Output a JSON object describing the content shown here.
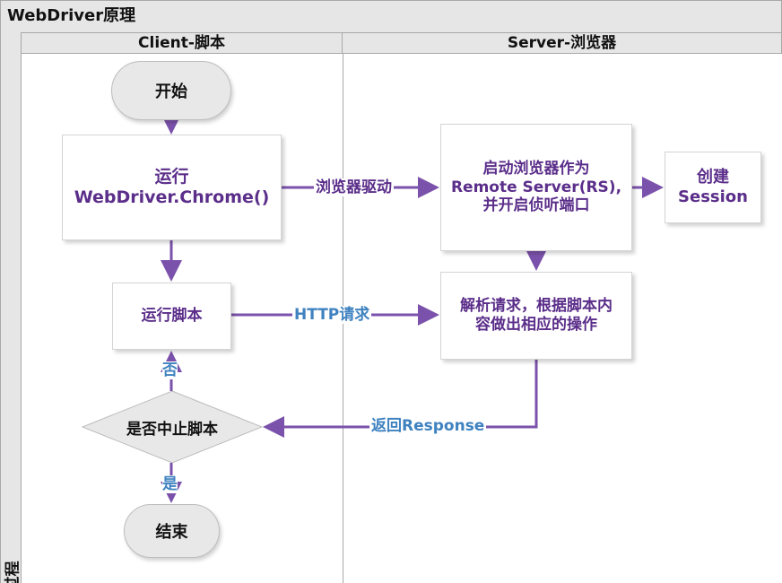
{
  "title": "WebDriver原理",
  "side_label": "过程",
  "lanes": {
    "client": "Client-脚本",
    "server": "Server-浏览器"
  },
  "nodes": {
    "start": "开始",
    "run_chrome": [
      "运行",
      "WebDriver.Chrome()"
    ],
    "run_script": "运行脚本",
    "launch_browser": [
      "启动浏览器作为",
      "Remote Server(RS),",
      "并开启侦听端口"
    ],
    "create_session": [
      "创建",
      "Session"
    ],
    "parse_request": [
      "解析请求，根据脚本内",
      "容做出相应的操作"
    ],
    "decision": "是否中止脚本",
    "end": "结束"
  },
  "edge_labels": {
    "browser_driver": "浏览器驱动",
    "http_request": "HTTP请求",
    "return_response": "返回Response",
    "no": "否",
    "yes": "是"
  },
  "colors": {
    "arrow": "#7b52ab",
    "node_text": "#5b2e8a",
    "label_blue": "#3f82c0",
    "lane_header": "#e6e6e6",
    "terminal_fill": "#e8e8e8"
  }
}
